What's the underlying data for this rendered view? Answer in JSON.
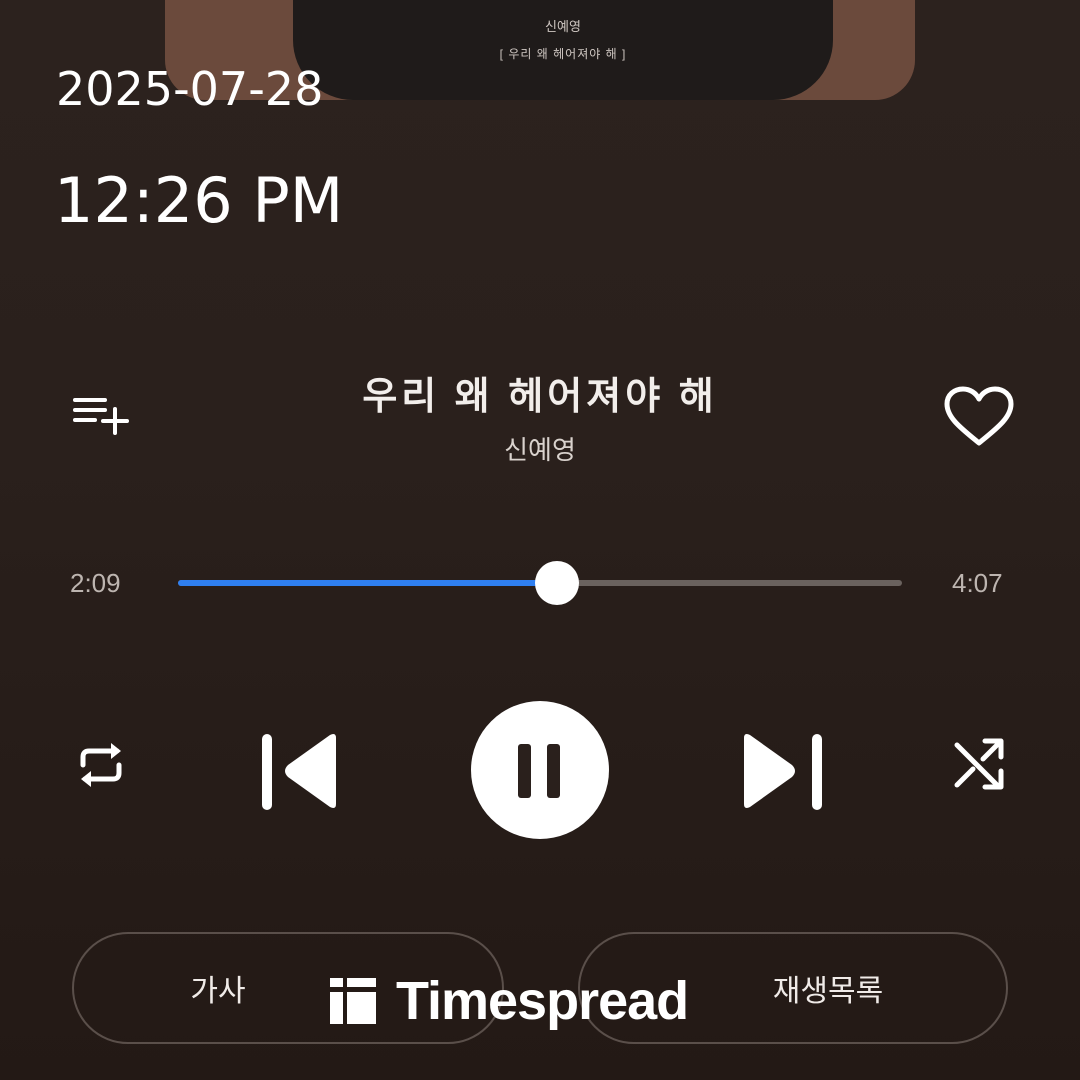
{
  "album_art": {
    "artist": "신예영",
    "album": "[ 우리 왜 헤어져야 해 ]"
  },
  "status": {
    "date": "2025-07-28",
    "time": "12:26 PM"
  },
  "track": {
    "title": "우리 왜 헤어져야 해",
    "artist": "신예영"
  },
  "playback": {
    "elapsed": "2:09",
    "duration": "4:07",
    "progress_fraction": 0.523,
    "accent_color": "#2f7ff0"
  },
  "icons": {
    "add_playlist": "playlist-add-icon",
    "like": "heart-outline-icon",
    "repeat": "repeat-icon",
    "previous": "skip-previous-icon",
    "pause": "pause-icon",
    "next": "skip-next-icon",
    "shuffle": "shuffle-icon"
  },
  "buttons": {
    "lyrics_label": "가사",
    "queue_label": "재생목록"
  },
  "watermark": {
    "text": "Timespread"
  }
}
